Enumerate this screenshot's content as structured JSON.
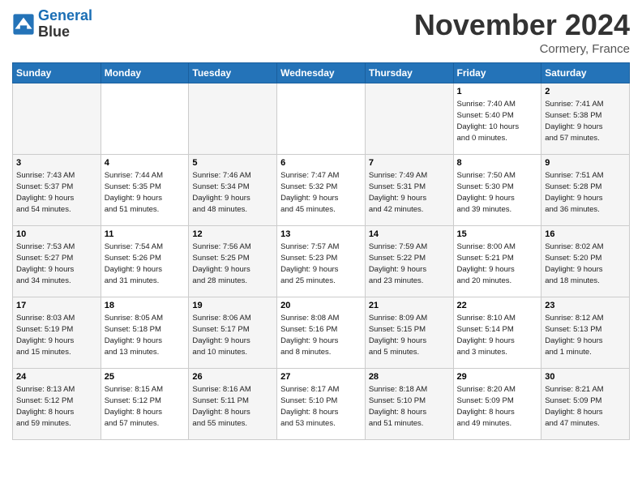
{
  "header": {
    "logo_line1": "General",
    "logo_line2": "Blue",
    "month": "November 2024",
    "location": "Cormery, France"
  },
  "weekdays": [
    "Sunday",
    "Monday",
    "Tuesday",
    "Wednesday",
    "Thursday",
    "Friday",
    "Saturday"
  ],
  "weeks": [
    [
      {
        "day": "",
        "info": ""
      },
      {
        "day": "",
        "info": ""
      },
      {
        "day": "",
        "info": ""
      },
      {
        "day": "",
        "info": ""
      },
      {
        "day": "",
        "info": ""
      },
      {
        "day": "1",
        "info": "Sunrise: 7:40 AM\nSunset: 5:40 PM\nDaylight: 10 hours\nand 0 minutes."
      },
      {
        "day": "2",
        "info": "Sunrise: 7:41 AM\nSunset: 5:38 PM\nDaylight: 9 hours\nand 57 minutes."
      }
    ],
    [
      {
        "day": "3",
        "info": "Sunrise: 7:43 AM\nSunset: 5:37 PM\nDaylight: 9 hours\nand 54 minutes."
      },
      {
        "day": "4",
        "info": "Sunrise: 7:44 AM\nSunset: 5:35 PM\nDaylight: 9 hours\nand 51 minutes."
      },
      {
        "day": "5",
        "info": "Sunrise: 7:46 AM\nSunset: 5:34 PM\nDaylight: 9 hours\nand 48 minutes."
      },
      {
        "day": "6",
        "info": "Sunrise: 7:47 AM\nSunset: 5:32 PM\nDaylight: 9 hours\nand 45 minutes."
      },
      {
        "day": "7",
        "info": "Sunrise: 7:49 AM\nSunset: 5:31 PM\nDaylight: 9 hours\nand 42 minutes."
      },
      {
        "day": "8",
        "info": "Sunrise: 7:50 AM\nSunset: 5:30 PM\nDaylight: 9 hours\nand 39 minutes."
      },
      {
        "day": "9",
        "info": "Sunrise: 7:51 AM\nSunset: 5:28 PM\nDaylight: 9 hours\nand 36 minutes."
      }
    ],
    [
      {
        "day": "10",
        "info": "Sunrise: 7:53 AM\nSunset: 5:27 PM\nDaylight: 9 hours\nand 34 minutes."
      },
      {
        "day": "11",
        "info": "Sunrise: 7:54 AM\nSunset: 5:26 PM\nDaylight: 9 hours\nand 31 minutes."
      },
      {
        "day": "12",
        "info": "Sunrise: 7:56 AM\nSunset: 5:25 PM\nDaylight: 9 hours\nand 28 minutes."
      },
      {
        "day": "13",
        "info": "Sunrise: 7:57 AM\nSunset: 5:23 PM\nDaylight: 9 hours\nand 25 minutes."
      },
      {
        "day": "14",
        "info": "Sunrise: 7:59 AM\nSunset: 5:22 PM\nDaylight: 9 hours\nand 23 minutes."
      },
      {
        "day": "15",
        "info": "Sunrise: 8:00 AM\nSunset: 5:21 PM\nDaylight: 9 hours\nand 20 minutes."
      },
      {
        "day": "16",
        "info": "Sunrise: 8:02 AM\nSunset: 5:20 PM\nDaylight: 9 hours\nand 18 minutes."
      }
    ],
    [
      {
        "day": "17",
        "info": "Sunrise: 8:03 AM\nSunset: 5:19 PM\nDaylight: 9 hours\nand 15 minutes."
      },
      {
        "day": "18",
        "info": "Sunrise: 8:05 AM\nSunset: 5:18 PM\nDaylight: 9 hours\nand 13 minutes."
      },
      {
        "day": "19",
        "info": "Sunrise: 8:06 AM\nSunset: 5:17 PM\nDaylight: 9 hours\nand 10 minutes."
      },
      {
        "day": "20",
        "info": "Sunrise: 8:08 AM\nSunset: 5:16 PM\nDaylight: 9 hours\nand 8 minutes."
      },
      {
        "day": "21",
        "info": "Sunrise: 8:09 AM\nSunset: 5:15 PM\nDaylight: 9 hours\nand 5 minutes."
      },
      {
        "day": "22",
        "info": "Sunrise: 8:10 AM\nSunset: 5:14 PM\nDaylight: 9 hours\nand 3 minutes."
      },
      {
        "day": "23",
        "info": "Sunrise: 8:12 AM\nSunset: 5:13 PM\nDaylight: 9 hours\nand 1 minute."
      }
    ],
    [
      {
        "day": "24",
        "info": "Sunrise: 8:13 AM\nSunset: 5:12 PM\nDaylight: 8 hours\nand 59 minutes."
      },
      {
        "day": "25",
        "info": "Sunrise: 8:15 AM\nSunset: 5:12 PM\nDaylight: 8 hours\nand 57 minutes."
      },
      {
        "day": "26",
        "info": "Sunrise: 8:16 AM\nSunset: 5:11 PM\nDaylight: 8 hours\nand 55 minutes."
      },
      {
        "day": "27",
        "info": "Sunrise: 8:17 AM\nSunset: 5:10 PM\nDaylight: 8 hours\nand 53 minutes."
      },
      {
        "day": "28",
        "info": "Sunrise: 8:18 AM\nSunset: 5:10 PM\nDaylight: 8 hours\nand 51 minutes."
      },
      {
        "day": "29",
        "info": "Sunrise: 8:20 AM\nSunset: 5:09 PM\nDaylight: 8 hours\nand 49 minutes."
      },
      {
        "day": "30",
        "info": "Sunrise: 8:21 AM\nSunset: 5:09 PM\nDaylight: 8 hours\nand 47 minutes."
      }
    ]
  ]
}
